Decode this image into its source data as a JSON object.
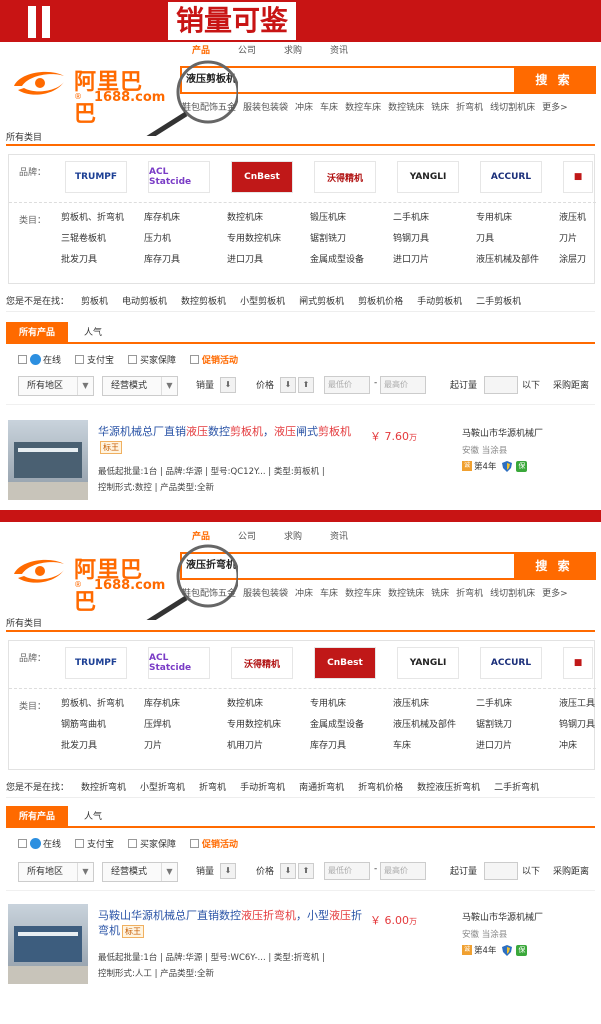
{
  "banner": {
    "title": "销量可鉴"
  },
  "pages": [
    {
      "logo": {
        "cn": "阿里巴巴",
        "en": "1688.com",
        "reg": "®"
      },
      "search_tabs": [
        "产品",
        "公司",
        "求购",
        "资讯"
      ],
      "search_query": "液压剪板机",
      "search_button": "搜 索",
      "hot_words": [
        "鞋包配饰五金",
        "服装包装袋",
        "冲床",
        "车床",
        "数控车床",
        "数控铣床",
        "铣床",
        "折弯机",
        "线切割机床",
        "更多>"
      ],
      "all_categories": "所有类目",
      "brand_label": "品牌：",
      "brands": [
        "TRUMPF",
        "ACL Statcide",
        "CnBest",
        "沃得精机",
        "YANGLI",
        "ACCURL",
        "■"
      ],
      "category_label": "类目：",
      "categories": [
        "剪板机、折弯机",
        "库存机床",
        "数控机床",
        "锻压机床",
        "二手机床",
        "专用机床",
        "液压机",
        "三辊卷板机",
        "压力机",
        "专用数控机床",
        "锯割铣刀",
        "钨钢刀具",
        "刀具",
        "刀片",
        "批发刀具",
        "库存刀具",
        "进口刀具",
        "金属成型设备",
        "进口刀片",
        "液压机械及部件",
        "涂层刀"
      ],
      "suggest_label": "您是不是在找：",
      "suggestions": [
        "剪板机",
        "电动剪板机",
        "数控剪板机",
        "小型剪板机",
        "闸式剪板机",
        "剪板机价格",
        "手动剪板机",
        "二手剪板机"
      ],
      "tab_active": "所有产品",
      "tab_other": "人气",
      "checks": [
        "在线",
        "支付宝",
        "买家保障"
      ],
      "promo": "促销活动",
      "region": "所有地区",
      "mode": "经营模式",
      "sales_label": "销量",
      "price_label": "价格",
      "price_low": "最低价",
      "price_high": "最高价",
      "price_sep": "-",
      "moq_label": "起订量",
      "below_label": "以下",
      "distance_label": "采购距离",
      "product": {
        "title_parts": [
          "华源机械总厂直销",
          "液压",
          "数控",
          "剪板机",
          "，",
          "液压",
          "闸式",
          "剪板机"
        ],
        "badge": "标王",
        "price_symbol": "￥",
        "price": "7.60",
        "price_unit": "万",
        "meta1": "最低起批量:1台 | 品牌:华源 | 型号:QC12Y... | 类型:剪板机 |",
        "meta2": "控制形式:数控 | 产品类型:全新",
        "company": "马鞍山市华源机械厂",
        "location": "安徽 当涂县",
        "years": "第4年",
        "bao": "保"
      }
    },
    {
      "logo": {
        "cn": "阿里巴巴",
        "en": "1688.com",
        "reg": "®"
      },
      "search_tabs": [
        "产品",
        "公司",
        "求购",
        "资讯"
      ],
      "search_query": "液压折弯机",
      "search_button": "搜 索",
      "hot_words": [
        "鞋包配饰五金",
        "服装包装袋",
        "冲床",
        "车床",
        "数控车床",
        "数控铣床",
        "铣床",
        "折弯机",
        "线切割机床",
        "更多>"
      ],
      "all_categories": "所有类目",
      "brand_label": "品牌：",
      "brands": [
        "TRUMPF",
        "ACL Statcide",
        "沃得精机",
        "CnBest",
        "YANGLI",
        "ACCURL",
        "■"
      ],
      "category_label": "类目：",
      "categories": [
        "剪板机、折弯机",
        "库存机床",
        "数控机床",
        "专用机床",
        "液压机床",
        "二手机床",
        "液压工具",
        "钢筋弯曲机",
        "压焊机",
        "专用数控机床",
        "金属成型设备",
        "液压机械及部件",
        "锯割铣刀",
        "钨钢刀具",
        "批发刀具",
        "刀片",
        "机用刀片",
        "库存刀具",
        "车床",
        "进口刀片",
        "冲床"
      ],
      "suggest_label": "您是不是在找：",
      "suggestions": [
        "数控折弯机",
        "小型折弯机",
        "折弯机",
        "手动折弯机",
        "南通折弯机",
        "折弯机价格",
        "数控液压折弯机",
        "二手折弯机"
      ],
      "tab_active": "所有产品",
      "tab_other": "人气",
      "checks": [
        "在线",
        "支付宝",
        "买家保障"
      ],
      "promo": "促销活动",
      "region": "所有地区",
      "mode": "经营模式",
      "sales_label": "销量",
      "price_label": "价格",
      "price_low": "最低价",
      "price_high": "最高价",
      "price_sep": "-",
      "moq_label": "起订量",
      "below_label": "以下",
      "distance_label": "采购距离",
      "product": {
        "title_parts": [
          "马鞍山华源机械总厂直销数控",
          "液压",
          "折弯机",
          "，小型",
          "液压",
          "折弯机"
        ],
        "badge": "标王",
        "price_symbol": "￥",
        "price": "6.00",
        "price_unit": "万",
        "meta1": "最低起批量:1台 | 品牌:华源 | 型号:WC6Y-... | 类型:折弯机 |",
        "meta2": "控制形式:人工 | 产品类型:全新",
        "company": "马鞍山市华源机械厂",
        "location": "安徽 当涂县",
        "years": "第4年",
        "bao": "保"
      }
    }
  ]
}
